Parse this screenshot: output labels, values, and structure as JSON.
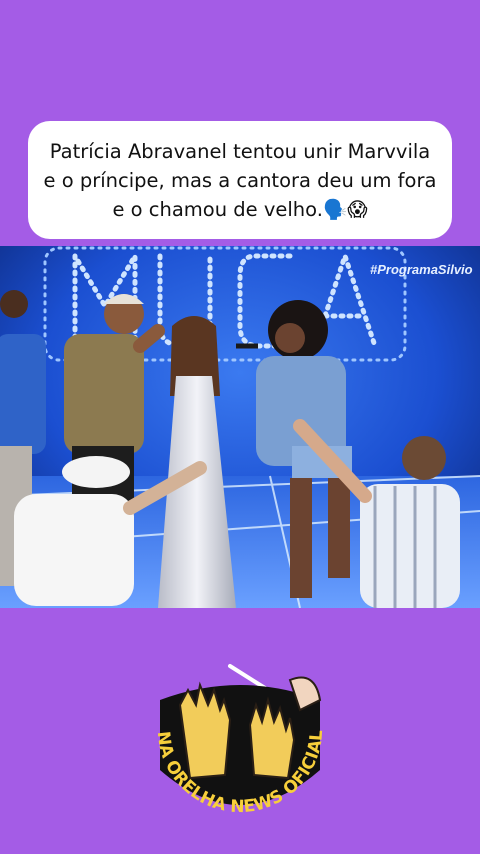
{
  "caption": {
    "text": "Patrícia Abravanel tentou unir Marvvila e o príncipe, mas a cantora deu um fora e o chamou de velho.🗣️😱"
  },
  "video_frame": {
    "hashtag": "#ProgramaSilvio",
    "stage_sign": "MÚSICA"
  },
  "logo": {
    "text": "NA ORELHA NEWS OFICIAL"
  },
  "colors": {
    "background": "#a45ce6",
    "card": "#ffffff",
    "stage_blue": "#1b4fd1",
    "logo_ring": "#111111",
    "logo_text": "#f7cf3b"
  }
}
